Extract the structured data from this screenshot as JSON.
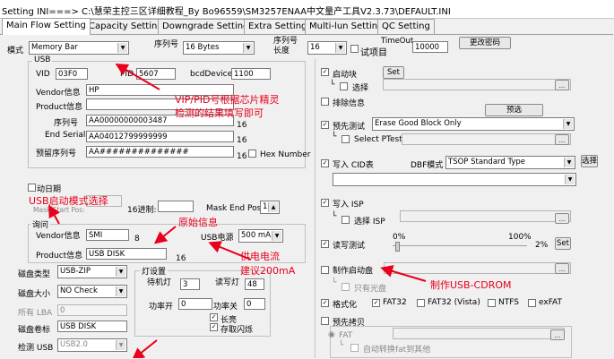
{
  "window": {
    "title": "Setting  INI===> C:\\慧荣主控三区详细教程_By Bo96559\\SM3257ENAA中文量产工具V2.3.73\\DEFAULT.INI"
  },
  "tabs": [
    "Main Flow Setting",
    "Capacity Setting",
    "Downgrade Setting",
    "Extra Setting",
    "Multi-lun Setting",
    "QC Setting"
  ],
  "top": {
    "mode_label": "模式",
    "mode_value": "Memory Bar",
    "serial_label": "序列号",
    "serial_value": "16 Bytes",
    "serial_len_label": "序列号长度",
    "serial_len_value": "16",
    "test_item_label": "试项目",
    "timeout_label": "TimeOut",
    "timeout_value": "10000",
    "change_pwd": "更改密码"
  },
  "usb": {
    "group": "USB",
    "vid_label": "VID",
    "vid_value": "03F0",
    "pid_label": "PID",
    "pid_value": "5607",
    "bcd_label": "bcdDevice",
    "bcd_value": "1100",
    "vendor_label": "Vendor信息",
    "vendor_value": "HP",
    "product_label": "Product信息",
    "product_value": "",
    "serial_label": "序列号",
    "serial_value": "AA00000000003487",
    "serial_num": "16",
    "end_label": "End Serial",
    "end_value": "AA04012799999999",
    "end_num": "16",
    "reserved_label": "预留序列号",
    "reserved_value": "AA##############",
    "reserved_num": "16",
    "hex_label": "Hex Number"
  },
  "boot": {
    "label": "动日期",
    "mask_label": "Mask Start Pos:",
    "mask_end_label": "Mask End Pos:",
    "mask_end_value": "10",
    "base_label": "16进制:"
  },
  "inquiry": {
    "group": "询问",
    "vendor_label": "Vendor信息",
    "vendor_value": "SMI",
    "vendor_num": "8",
    "product_label": "Product信息",
    "product_value": "USB DISK",
    "product_num": "16",
    "usb_power_label": "USB电源",
    "usb_power_value": "500 mA"
  },
  "disk": {
    "type_label": "磁盘类型",
    "type_value": "USB-ZIP",
    "size_label": "磁盘大小",
    "size_value": "NO Check",
    "lba_label": "所有 LBA",
    "lba_value": "0",
    "vol_label": "磁盘卷标",
    "vol_value": "USB DISK",
    "detect_label": "检测 USB",
    "detect_value": "USB2.0"
  },
  "led": {
    "group": "灯设置",
    "standby_label": "待机灯",
    "standby_value": "3",
    "rw_label": "读写灯",
    "rw_value": "48",
    "on_label": "功率开",
    "on_value": "0",
    "off_label": "功率关",
    "off_value": "0",
    "bright_label": "长亮",
    "flash_label": "存取闪烁"
  },
  "right": {
    "boot_block": "启动块",
    "set": "Set",
    "choose": "选择",
    "exclude": "排除信息",
    "preset_btn": "预选",
    "pretest": "预先测试",
    "pretest_value": "Erase Good Block Only",
    "select_ptest": "Select PTest",
    "write_cid": "写入 CID表",
    "dbf_label": "DBF模式",
    "dbf_value": "TSOP Standard Type",
    "dbf_btn": "选择",
    "write_isp": "写入 ISP",
    "choose_isp": "选择 ISP",
    "rw_test": "读写测试",
    "pct0": "0%",
    "pct100": "100%",
    "pct2": "2%",
    "set2": "Set",
    "make_boot": "制作启动盘",
    "cdrom_only": "只有光盘",
    "format": "格式化",
    "fat32": "FAT32",
    "fat32v": "FAT32 (Vista)",
    "ntfs": "NTFS",
    "exfat": "exFAT",
    "pre_copy": "预先拷贝",
    "fat": "FAT",
    "auto_conv": "自动转换fat到其他"
  },
  "annotations": {
    "a1": "VIP/PID号根据芯片精灵",
    "a2": "检测的结果填写即可",
    "a3": "USB启动模式选择",
    "a4": "原始信息",
    "a5": "供电电流",
    "a6": "建议200mA",
    "a7": "制作USB-CDROM"
  }
}
